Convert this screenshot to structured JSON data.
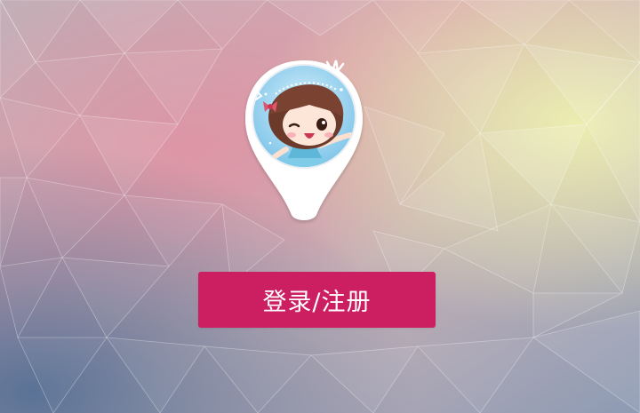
{
  "background": {
    "style": "low-poly pastel gradient",
    "colors": [
      "#c8a8b4",
      "#d99aa8",
      "#e8e2ad",
      "#6b7f9e",
      "#9aa0b8"
    ]
  },
  "avatar": {
    "icon": "cartoon-girl-avatar-icon",
    "accent": "#7ec3ea"
  },
  "login_button": {
    "label": "登录/注册",
    "color": "#cc1f62"
  }
}
